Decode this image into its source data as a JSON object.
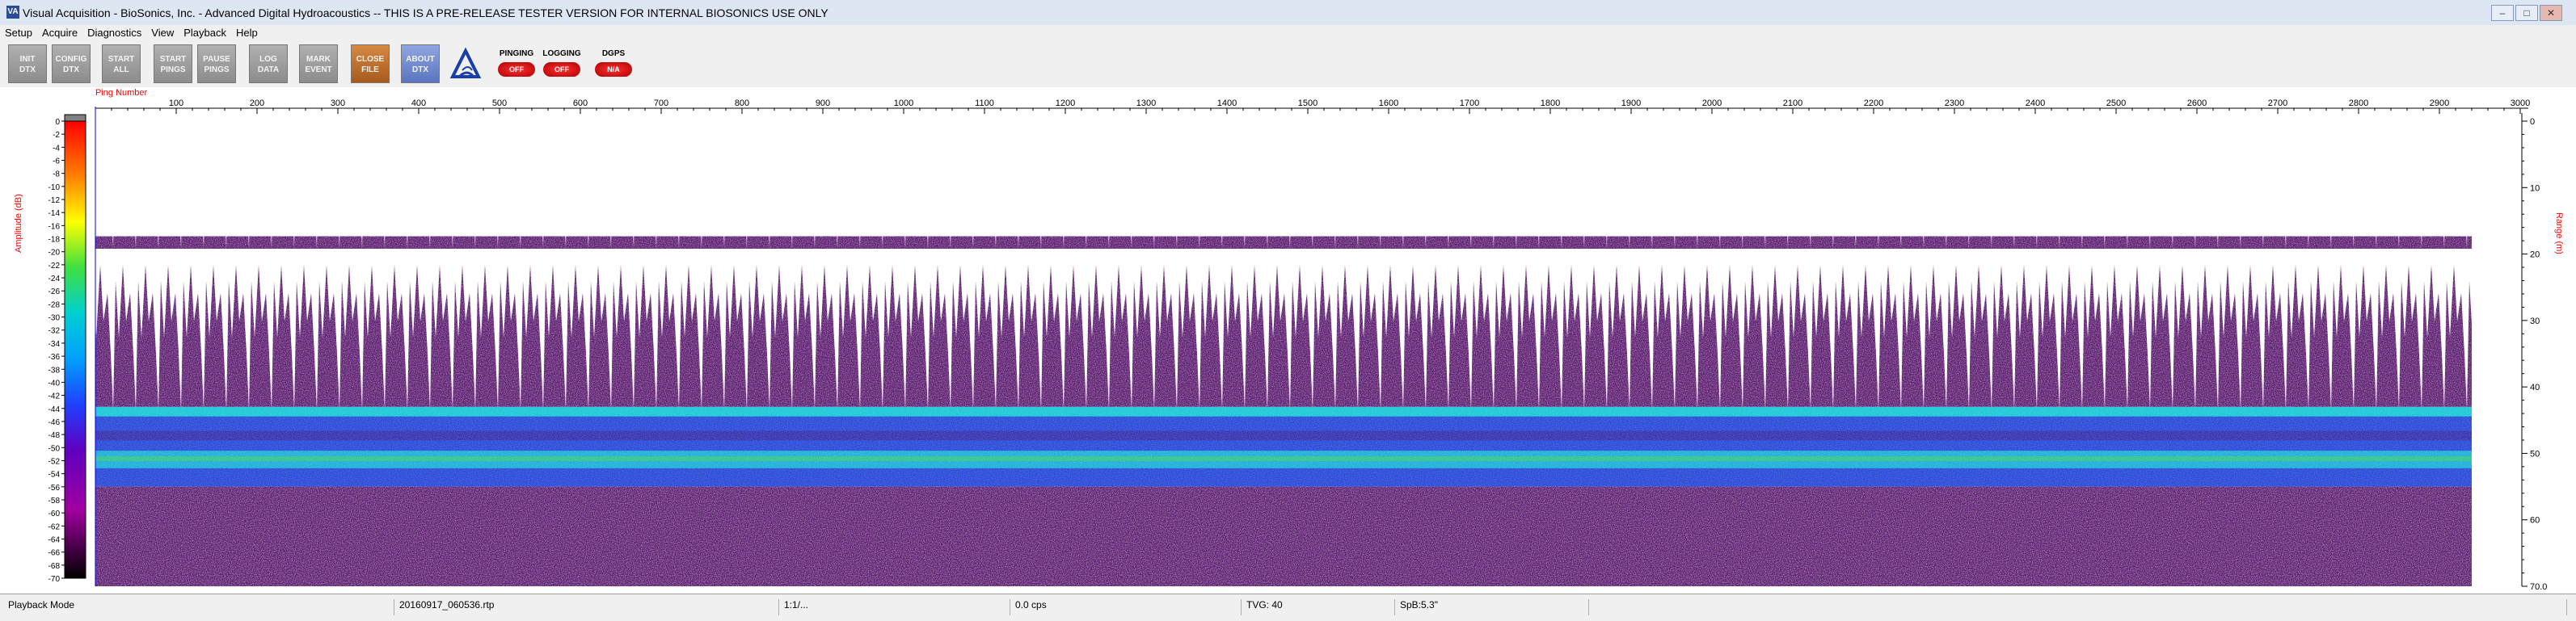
{
  "window": {
    "title": "Visual Acquisition  -  BioSonics, Inc.  -  Advanced Digital Hydroacoustics  -- THIS IS A PRE-RELEASE TESTER VERSION FOR INTERNAL BIOSONICS USE ONLY",
    "app_icon": "VA"
  },
  "menu": [
    "Setup",
    "Acquire",
    "Diagnostics",
    "View",
    "Playback",
    "Help"
  ],
  "toolbar": {
    "buttons": [
      {
        "line1": "INIT",
        "line2": "DTX"
      },
      {
        "line1": "CONFIG",
        "line2": "DTX"
      },
      {
        "line1": "START",
        "line2": "ALL"
      },
      {
        "line1": "START",
        "line2": "PINGS"
      },
      {
        "line1": "PAUSE",
        "line2": "PINGS"
      },
      {
        "line1": "LOG",
        "line2": "DATA"
      },
      {
        "line1": "MARK",
        "line2": "EVENT"
      },
      {
        "line1": "CLOSE",
        "line2": "FILE"
      },
      {
        "line1": "ABOUT",
        "line2": "DTX"
      }
    ],
    "indicators": [
      {
        "label": "PINGING",
        "state": "OFF"
      },
      {
        "label": "LOGGING",
        "state": "OFF"
      },
      {
        "label": "DGPS",
        "state": "N/A"
      }
    ]
  },
  "chart_data": {
    "type": "heatmap",
    "title": "",
    "xlabel": "Ping Number",
    "ylabel_left": "Amplitude (dB)",
    "ylabel_right": "Range (m)",
    "x_ticks": [
      100,
      200,
      300,
      400,
      500,
      600,
      700,
      800,
      900,
      1000,
      1100,
      1200,
      1300,
      1400,
      1500,
      1600,
      1700,
      1800,
      1900,
      2000,
      2100,
      2200,
      2300,
      2400,
      2500,
      2600,
      2700,
      2800,
      2900,
      3000
    ],
    "xlim": [
      0,
      3000
    ],
    "range_ticks": [
      0,
      10,
      20,
      30,
      40,
      50,
      60,
      70
    ],
    "range_max_label": "70.0",
    "ylim": [
      0,
      70
    ],
    "colorbar_ticks": [
      0,
      -2,
      -4,
      -6,
      -8,
      -10,
      -12,
      -14,
      -16,
      -18,
      -20,
      -22,
      -24,
      -26,
      -28,
      -30,
      -32,
      -34,
      -36,
      -38,
      -40,
      -42,
      -44,
      -46,
      -48,
      -50,
      -52,
      -54,
      -56,
      -58,
      -60,
      -62,
      -64,
      -66,
      -68,
      -70
    ],
    "colorbar_range_db": [
      -70,
      0
    ],
    "data_extent_pings": 2940,
    "surface_noise_range_m": [
      20,
      43
    ],
    "layer_range_m": [
      43,
      55
    ],
    "deep_noise_range_m": [
      55,
      70
    ],
    "colors": {
      "noise": "#5a1a6e",
      "layer_blue": "#2a4ad8",
      "layer_cyan": "#1ac8d8",
      "layer_green": "#4ad84a",
      "axis_label": "#ff0000"
    }
  },
  "statusbar": {
    "mode": "Playback Mode",
    "file": "20160917_060536.rtp",
    "ratio": "1:1/...",
    "rate": "0.0 cps",
    "tvg": "TVG: 40",
    "spb": "SpB:5.3\""
  }
}
